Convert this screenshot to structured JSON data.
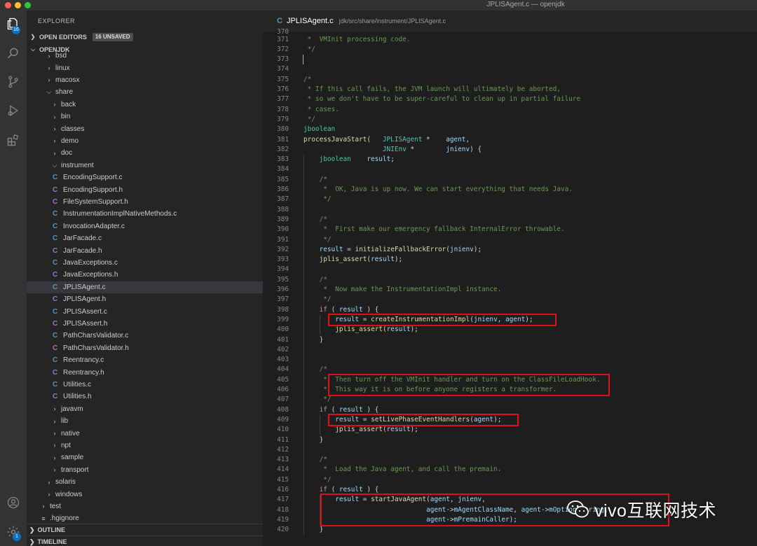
{
  "window": {
    "title": "JPLISAgent.c — openjdk",
    "traffic_colors": [
      "#fe5f57",
      "#febc2e",
      "#28c840"
    ]
  },
  "activity_bar": {
    "explorer_badge": "16",
    "account_badge": "1"
  },
  "sidebar": {
    "header": "EXPLORER",
    "open_editors_label": "OPEN EDITORS",
    "unsaved_badge": "16 UNSAVED",
    "project_label": "OPENJDK",
    "items": [
      {
        "label": "bsd",
        "kind": "folder",
        "depth": 3,
        "open": false
      },
      {
        "label": "linux",
        "kind": "folder",
        "depth": 3,
        "open": false
      },
      {
        "label": "macosx",
        "kind": "folder",
        "depth": 3,
        "open": false
      },
      {
        "label": "share",
        "kind": "folder",
        "depth": 3,
        "open": true
      },
      {
        "label": "back",
        "kind": "folder",
        "depth": 4,
        "open": false
      },
      {
        "label": "bin",
        "kind": "folder",
        "depth": 4,
        "open": false
      },
      {
        "label": "classes",
        "kind": "folder",
        "depth": 4,
        "open": false
      },
      {
        "label": "demo",
        "kind": "folder",
        "depth": 4,
        "open": false
      },
      {
        "label": "doc",
        "kind": "folder",
        "depth": 4,
        "open": false
      },
      {
        "label": "instrument",
        "kind": "folder",
        "depth": 4,
        "open": true
      },
      {
        "label": "EncodingSupport.c",
        "kind": "c",
        "depth": 5
      },
      {
        "label": "EncodingSupport.h",
        "kind": "h",
        "depth": 5
      },
      {
        "label": "FileSystemSupport.h",
        "kind": "h",
        "depth": 5
      },
      {
        "label": "InstrumentationImplNativeMethods.c",
        "kind": "c",
        "depth": 5
      },
      {
        "label": "InvocationAdapter.c",
        "kind": "c",
        "depth": 5
      },
      {
        "label": "JarFacade.c",
        "kind": "c",
        "depth": 5
      },
      {
        "label": "JarFacade.h",
        "kind": "h",
        "depth": 5
      },
      {
        "label": "JavaExceptions.c",
        "kind": "c",
        "depth": 5
      },
      {
        "label": "JavaExceptions.h",
        "kind": "h",
        "depth": 5
      },
      {
        "label": "JPLISAgent.c",
        "kind": "c",
        "depth": 5,
        "selected": true
      },
      {
        "label": "JPLISAgent.h",
        "kind": "h",
        "depth": 5
      },
      {
        "label": "JPLISAssert.c",
        "kind": "c",
        "depth": 5
      },
      {
        "label": "JPLISAssert.h",
        "kind": "h",
        "depth": 5
      },
      {
        "label": "PathCharsValidator.c",
        "kind": "c",
        "depth": 5
      },
      {
        "label": "PathCharsValidator.h",
        "kind": "h",
        "depth": 5
      },
      {
        "label": "Reentrancy.c",
        "kind": "c",
        "depth": 5
      },
      {
        "label": "Reentrancy.h",
        "kind": "h",
        "depth": 5
      },
      {
        "label": "Utilities.c",
        "kind": "c",
        "depth": 5
      },
      {
        "label": "Utilities.h",
        "kind": "h",
        "depth": 5
      },
      {
        "label": "javavm",
        "kind": "folder",
        "depth": 4,
        "open": false
      },
      {
        "label": "lib",
        "kind": "folder",
        "depth": 4,
        "open": false
      },
      {
        "label": "native",
        "kind": "folder",
        "depth": 4,
        "open": false
      },
      {
        "label": "npt",
        "kind": "folder",
        "depth": 4,
        "open": false
      },
      {
        "label": "sample",
        "kind": "folder",
        "depth": 4,
        "open": false
      },
      {
        "label": "transport",
        "kind": "folder",
        "depth": 4,
        "open": false
      },
      {
        "label": "solaris",
        "kind": "folder",
        "depth": 3,
        "open": false
      },
      {
        "label": "windows",
        "kind": "folder",
        "depth": 3,
        "open": false
      },
      {
        "label": "test",
        "kind": "folder",
        "depth": 2,
        "open": false
      },
      {
        "label": ".hgignore",
        "kind": "file",
        "depth": 2
      }
    ],
    "outline_label": "OUTLINE",
    "timeline_label": "TIMELINE"
  },
  "editor": {
    "tab_name": "JPLISAgent.c",
    "tab_path": "jdk/src/share/instrument/JPLISAgent.c",
    "top_line_number": "370",
    "lines": [
      {
        "n": "371",
        "i": 0,
        "s": [
          [
            "cm",
            " *  VMInit processing code."
          ]
        ]
      },
      {
        "n": "372",
        "i": 0,
        "s": [
          [
            "cm",
            " */"
          ]
        ]
      },
      {
        "n": "373",
        "i": 0,
        "s": []
      },
      {
        "n": "374",
        "i": 0,
        "s": []
      },
      {
        "n": "375",
        "i": 0,
        "s": [
          [
            "cm",
            "/*"
          ]
        ]
      },
      {
        "n": "376",
        "i": 0,
        "s": [
          [
            "cm",
            " * If this call fails, the JVM launch will ultimately be aborted,"
          ]
        ]
      },
      {
        "n": "377",
        "i": 0,
        "s": [
          [
            "cm",
            " * so we don't have to be super-careful to clean up in partial failure"
          ]
        ]
      },
      {
        "n": "378",
        "i": 0,
        "s": [
          [
            "cm",
            " * cases."
          ]
        ]
      },
      {
        "n": "379",
        "i": 0,
        "s": [
          [
            "cm",
            " */"
          ]
        ]
      },
      {
        "n": "380",
        "i": 0,
        "s": [
          [
            "ty",
            "jboolean"
          ]
        ]
      },
      {
        "n": "381",
        "i": 0,
        "s": [
          [
            "fn",
            "processJavaStart"
          ],
          [
            "",
            "(   "
          ],
          [
            "ty",
            "JPLISAgent"
          ],
          [
            "",
            " *    "
          ],
          [
            "vr",
            "agent"
          ],
          [
            "",
            ","
          ]
        ]
      },
      {
        "n": "382",
        "i": 0,
        "s": [
          [
            "",
            "                    "
          ],
          [
            "ty",
            "JNIEnv"
          ],
          [
            "",
            " *        "
          ],
          [
            "vr",
            "jnienv"
          ],
          [
            "",
            ") {"
          ]
        ]
      },
      {
        "n": "383",
        "i": 1,
        "s": [
          [
            "ty",
            "jboolean"
          ],
          [
            "",
            "    "
          ],
          [
            "vr",
            "result"
          ],
          [
            "",
            ";"
          ]
        ]
      },
      {
        "n": "384",
        "i": 0,
        "s": []
      },
      {
        "n": "385",
        "i": 1,
        "s": [
          [
            "cm",
            "/*"
          ]
        ]
      },
      {
        "n": "386",
        "i": 1,
        "s": [
          [
            "cm",
            " *  OK, Java is up now. We can start everything that needs Java."
          ]
        ]
      },
      {
        "n": "387",
        "i": 1,
        "s": [
          [
            "cm",
            " */"
          ]
        ]
      },
      {
        "n": "388",
        "i": 0,
        "s": []
      },
      {
        "n": "389",
        "i": 1,
        "s": [
          [
            "cm",
            "/*"
          ]
        ]
      },
      {
        "n": "390",
        "i": 1,
        "s": [
          [
            "cm",
            " *  First make our emergency fallback InternalError throwable."
          ]
        ]
      },
      {
        "n": "391",
        "i": 1,
        "s": [
          [
            "cm",
            " */"
          ]
        ]
      },
      {
        "n": "392",
        "i": 1,
        "s": [
          [
            "vr",
            "result"
          ],
          [
            "",
            " = "
          ],
          [
            "fn",
            "initializeFallbackError"
          ],
          [
            "",
            "("
          ],
          [
            "vr",
            "jnienv"
          ],
          [
            "",
            ");"
          ]
        ]
      },
      {
        "n": "393",
        "i": 1,
        "s": [
          [
            "fn",
            "jplis_assert"
          ],
          [
            "",
            "("
          ],
          [
            "vr",
            "result"
          ],
          [
            "",
            ");"
          ]
        ]
      },
      {
        "n": "394",
        "i": 0,
        "s": []
      },
      {
        "n": "395",
        "i": 1,
        "s": [
          [
            "cm",
            "/*"
          ]
        ]
      },
      {
        "n": "396",
        "i": 1,
        "s": [
          [
            "cm",
            " *  Now make the InstrumentationImpl instance."
          ]
        ]
      },
      {
        "n": "397",
        "i": 1,
        "s": [
          [
            "cm",
            " */"
          ]
        ]
      },
      {
        "n": "398",
        "i": 1,
        "s": [
          [
            "kw",
            "if"
          ],
          [
            "",
            " ( "
          ],
          [
            "vr",
            "result"
          ],
          [
            "",
            " ) {"
          ]
        ]
      },
      {
        "n": "399",
        "i": 2,
        "s": [
          [
            "vr",
            "result"
          ],
          [
            "",
            " = "
          ],
          [
            "fn",
            "createInstrumentationImpl"
          ],
          [
            "",
            "("
          ],
          [
            "vr",
            "jnienv"
          ],
          [
            "",
            ", "
          ],
          [
            "vr",
            "agent"
          ],
          [
            "",
            ");"
          ]
        ]
      },
      {
        "n": "400",
        "i": 2,
        "s": [
          [
            "fn",
            "jplis_assert"
          ],
          [
            "",
            "("
          ],
          [
            "vr",
            "result"
          ],
          [
            "",
            ");"
          ]
        ]
      },
      {
        "n": "401",
        "i": 1,
        "s": [
          [
            "",
            "}"
          ]
        ]
      },
      {
        "n": "402",
        "i": 0,
        "s": []
      },
      {
        "n": "403",
        "i": 0,
        "s": []
      },
      {
        "n": "404",
        "i": 1,
        "s": [
          [
            "cm",
            "/*"
          ]
        ]
      },
      {
        "n": "405",
        "i": 1,
        "s": [
          [
            "cm",
            " *  Then turn off the VMInit handler and turn on the ClassFileLoadHook."
          ]
        ]
      },
      {
        "n": "406",
        "i": 1,
        "s": [
          [
            "cm",
            " *  This way it is on before anyone registers a transformer."
          ]
        ]
      },
      {
        "n": "407",
        "i": 1,
        "s": [
          [
            "cm",
            " */"
          ]
        ]
      },
      {
        "n": "408",
        "i": 1,
        "s": [
          [
            "kw",
            "if"
          ],
          [
            "",
            " ( "
          ],
          [
            "vr",
            "result"
          ],
          [
            "",
            " ) {"
          ]
        ]
      },
      {
        "n": "409",
        "i": 2,
        "s": [
          [
            "vr",
            "result"
          ],
          [
            "",
            " = "
          ],
          [
            "fn",
            "setLivePhaseEventHandlers"
          ],
          [
            "",
            "("
          ],
          [
            "vr",
            "agent"
          ],
          [
            "",
            ");"
          ]
        ]
      },
      {
        "n": "410",
        "i": 2,
        "s": [
          [
            "fn",
            "jplis_assert"
          ],
          [
            "",
            "("
          ],
          [
            "vr",
            "result"
          ],
          [
            "",
            ");"
          ]
        ]
      },
      {
        "n": "411",
        "i": 1,
        "s": [
          [
            "",
            "}"
          ]
        ]
      },
      {
        "n": "412",
        "i": 0,
        "s": []
      },
      {
        "n": "413",
        "i": 1,
        "s": [
          [
            "cm",
            "/*"
          ]
        ]
      },
      {
        "n": "414",
        "i": 1,
        "s": [
          [
            "cm",
            " *  Load the Java agent, and call the premain."
          ]
        ]
      },
      {
        "n": "415",
        "i": 1,
        "s": [
          [
            "cm",
            " */"
          ]
        ]
      },
      {
        "n": "416",
        "i": 1,
        "s": [
          [
            "kw",
            "if"
          ],
          [
            "",
            " ( "
          ],
          [
            "vr",
            "result"
          ],
          [
            "",
            " ) {"
          ]
        ]
      },
      {
        "n": "417",
        "i": 2,
        "s": [
          [
            "vr",
            "result"
          ],
          [
            "",
            " = "
          ],
          [
            "fn",
            "startJavaAgent"
          ],
          [
            "",
            "("
          ],
          [
            "vr",
            "agent"
          ],
          [
            "",
            ", "
          ],
          [
            "vr",
            "jnienv"
          ],
          [
            "",
            ","
          ]
        ]
      },
      {
        "n": "418",
        "i": 2,
        "s": [
          [
            "",
            "                       "
          ],
          [
            "vr",
            "agent"
          ],
          [
            "",
            "->"
          ],
          [
            "vr",
            "mAgentClassName"
          ],
          [
            "",
            ", "
          ],
          [
            "vr",
            "agent"
          ],
          [
            "",
            "->"
          ],
          [
            "vr",
            "mOptionsString"
          ],
          [
            "",
            ","
          ]
        ]
      },
      {
        "n": "419",
        "i": 2,
        "s": [
          [
            "",
            "                       "
          ],
          [
            "vr",
            "agent"
          ],
          [
            "",
            "->"
          ],
          [
            "vr",
            "mPremainCaller"
          ],
          [
            "",
            ");"
          ]
        ]
      },
      {
        "n": "420",
        "i": 1,
        "s": [
          [
            "",
            "}"
          ]
        ]
      }
    ]
  },
  "watermark": {
    "text": "vivo互联网技术"
  },
  "colors": {
    "highlight_box": "#e0101a",
    "accent_badge": "#0e70c0"
  }
}
